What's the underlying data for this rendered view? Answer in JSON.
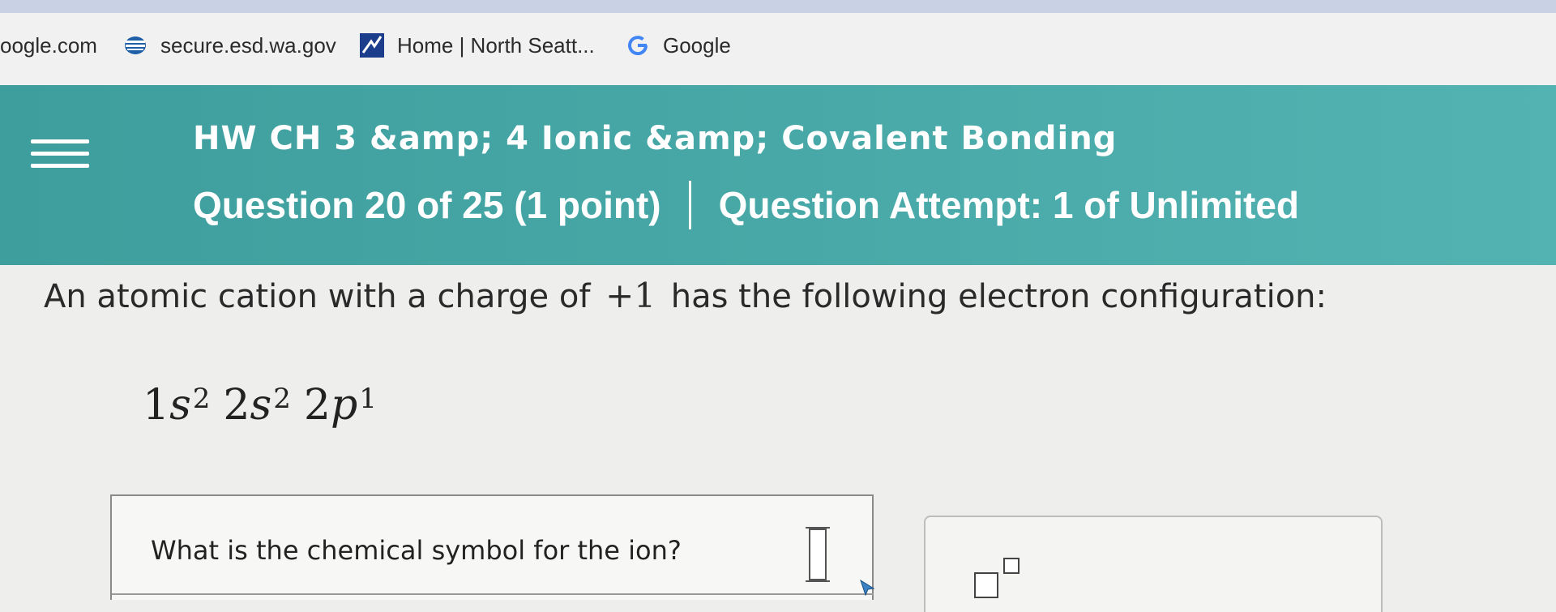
{
  "bookmarks": [
    {
      "label": "oogle.com",
      "icon": "none"
    },
    {
      "label": "secure.esd.wa.gov",
      "icon": "site-stripes-icon"
    },
    {
      "label": "Home | North Seatt...",
      "icon": "north-seattle-icon"
    },
    {
      "label": "Google",
      "icon": "google-g-icon"
    }
  ],
  "header": {
    "title": "HW CH 3 &amp; 4 Ionic &amp; Covalent Bonding",
    "question_info": "Question 20 of 25 (1 point)",
    "attempt_info": "Question Attempt: 1 of Unlimited"
  },
  "question": {
    "text_before": "An atomic cation with a charge of",
    "charge": "+1",
    "text_after": "has the following electron configuration:",
    "configuration": [
      {
        "coef": "1",
        "orbital": "s",
        "exp": "2"
      },
      {
        "coef": "2",
        "orbital": "s",
        "exp": "2"
      },
      {
        "coef": "2",
        "orbital": "p",
        "exp": "1"
      }
    ]
  },
  "answer": {
    "prompt": "What is the chemical symbol for the ion?"
  },
  "colors": {
    "header_teal": "#48a8a7",
    "bookmark_bar": "#f1f1f1",
    "page_bg": "#eeeeec",
    "google_blue": "#4285f4"
  }
}
